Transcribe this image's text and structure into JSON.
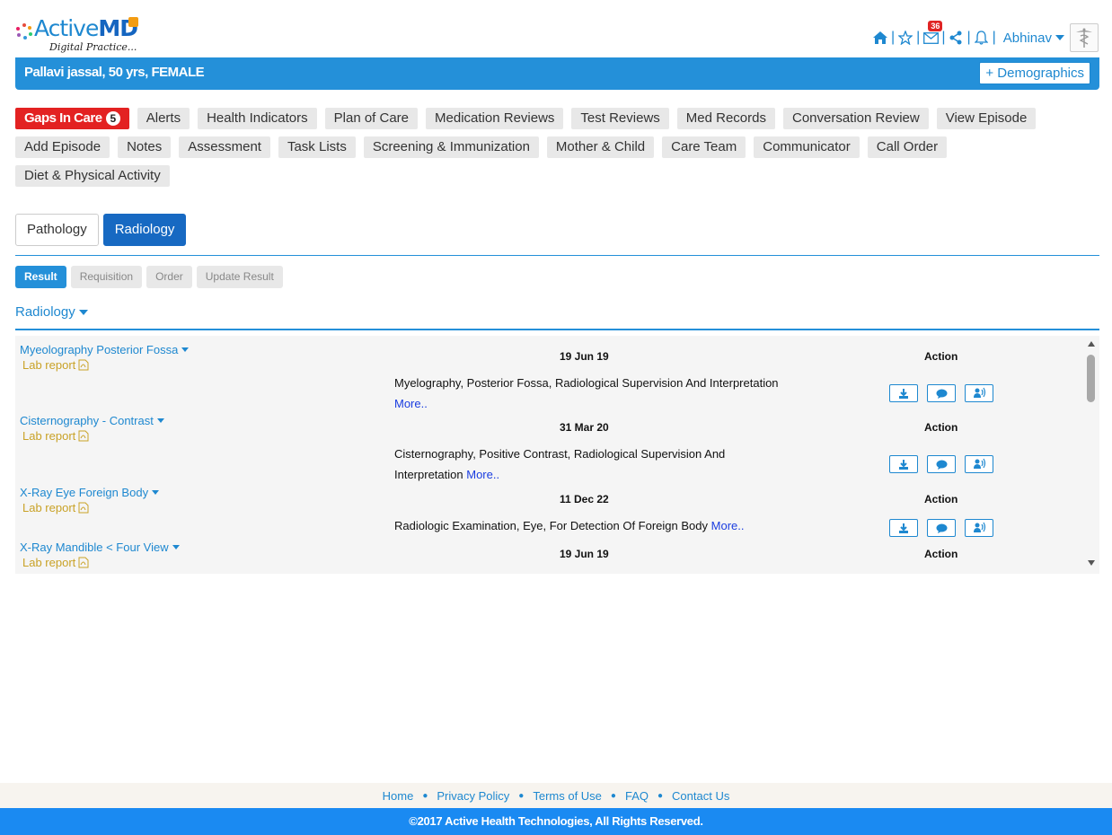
{
  "header": {
    "brand_light": "Active",
    "brand_bold": "MD",
    "tagline": "Digital Practice...",
    "mail_count": "36",
    "user_name": "Abhinav",
    "separator": "|"
  },
  "patient": {
    "name": "Pallavi jassal, 50 yrs, FEMALE",
    "demographics_label": "+ Demographics"
  },
  "nav": {
    "gaps_label": "Gaps In Care",
    "gaps_count": "5",
    "row1": [
      "Alerts",
      "Health Indicators",
      "Plan of Care",
      "Medication Reviews",
      "Test Reviews",
      "Med Records",
      "Conversation Review",
      "View Episode"
    ],
    "row2": [
      "Add Episode",
      "Notes",
      "Assessment",
      "Task Lists",
      "Screening & Immunization",
      "Mother & Child",
      "Care Team",
      "Communicator",
      "Call Order"
    ],
    "row3": [
      "Diet & Physical Activity"
    ]
  },
  "subtabs": [
    "Pathology",
    "Radiology"
  ],
  "pills": [
    "Result",
    "Requisition",
    "Order",
    "Update Result"
  ],
  "section_title": "Radiology",
  "records": [
    {
      "title": "Myeolography Posterior Fossa",
      "lab": "Lab report",
      "date": "19 Jun 19",
      "action": "Action",
      "desc": "Myelography, Posterior Fossa, Radiological Supervision And Interpretation",
      "more": "More.."
    },
    {
      "title": "Cisternography - Contrast",
      "lab": "Lab report",
      "date": "31 Mar 20",
      "action": "Action",
      "desc": "Cisternography, Positive Contrast, Radiological Supervision And Interpretation",
      "more": "More.."
    },
    {
      "title": "X-Ray Eye Foreign Body",
      "lab": "Lab report",
      "date": "11 Dec 22",
      "action": "Action",
      "desc": "Radiologic Examination, Eye, For Detection Of Foreign Body",
      "more": "More.."
    },
    {
      "title": "X-Ray Mandible < Four View",
      "lab": "Lab report",
      "date": "19 Jun 19",
      "action": "Action",
      "desc": "",
      "more": ""
    }
  ],
  "footer": {
    "links": [
      "Home",
      "Privacy Policy",
      "Terms of Use",
      "FAQ",
      "Contact Us"
    ],
    "copyright": "©2017 Active Health Technologies, All Rights Reserved."
  },
  "colors": {
    "primary": "#2490d9",
    "alert": "#e32222",
    "lab": "#c9a227",
    "footer": "#1a8af2"
  }
}
